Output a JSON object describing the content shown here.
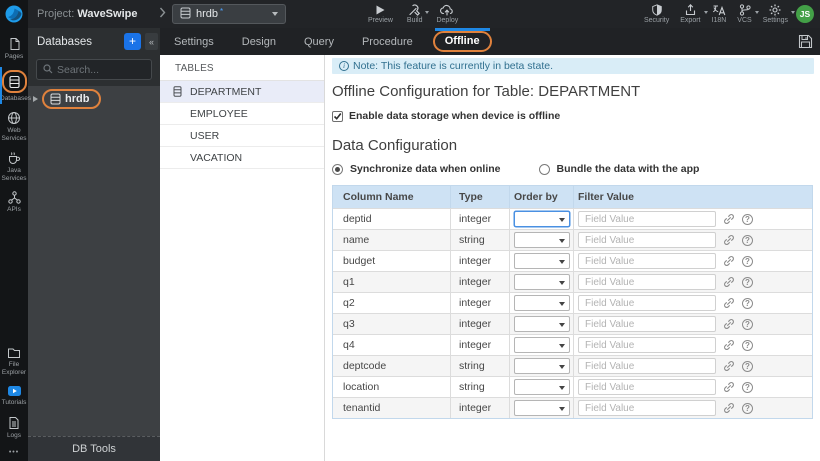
{
  "topbar": {
    "project_label": "Project:",
    "project_name": "WaveSwipe",
    "db_selector": {
      "value": "hrdb",
      "modified": "*"
    },
    "actions": {
      "preview": "Preview",
      "build": "Build",
      "deploy": "Deploy",
      "security": "Security",
      "export": "Export",
      "i18n": "I18N",
      "vcs": "VCS",
      "settings": "Settings"
    },
    "avatar": "JS"
  },
  "sidebar": {
    "items": [
      {
        "label": "Pages"
      },
      {
        "label": "Databases",
        "active": true
      },
      {
        "label": "Web Services"
      },
      {
        "label": "Java Services"
      },
      {
        "label": "APIs"
      },
      {
        "label": "File Explorer"
      },
      {
        "label": "Tutorials"
      },
      {
        "label": "Logs"
      }
    ],
    "more": "•••"
  },
  "db_panel": {
    "title": "Databases",
    "search_placeholder": "Search...",
    "items": [
      {
        "name": "hrdb"
      }
    ],
    "footer": "DB Tools"
  },
  "icons": {
    "add": "+",
    "collapse": "«",
    "info": "i",
    "help": "?"
  },
  "workspace": {
    "tabs": [
      {
        "label": "Settings"
      },
      {
        "label": "Design"
      },
      {
        "label": "Query"
      },
      {
        "label": "Procedure"
      },
      {
        "label": "Offline",
        "active": true
      }
    ]
  },
  "tables_panel": {
    "title": "TABLES",
    "items": [
      {
        "name": "DEPARTMENT",
        "active": true
      },
      {
        "name": "EMPLOYEE"
      },
      {
        "name": "USER"
      },
      {
        "name": "VACATION"
      }
    ]
  },
  "main": {
    "note": "Note: This feature is currently in beta state.",
    "title": "Offline Configuration for Table: DEPARTMENT",
    "enable_label": "Enable data storage when device is offline",
    "enable_checked": true,
    "section_title": "Data Configuration",
    "sync_options": [
      {
        "label": "Synchronize data when online",
        "selected": true
      },
      {
        "label": "Bundle the data with the app",
        "selected": false
      }
    ],
    "table": {
      "headers": [
        "Column Name",
        "Type",
        "Order by",
        "Filter Value"
      ],
      "filter_placeholder": "Field Value",
      "rows": [
        {
          "column": "deptid",
          "type": "integer"
        },
        {
          "column": "name",
          "type": "string"
        },
        {
          "column": "budget",
          "type": "integer"
        },
        {
          "column": "q1",
          "type": "integer"
        },
        {
          "column": "q2",
          "type": "integer"
        },
        {
          "column": "q3",
          "type": "integer"
        },
        {
          "column": "q4",
          "type": "integer"
        },
        {
          "column": "deptcode",
          "type": "string"
        },
        {
          "column": "location",
          "type": "string"
        },
        {
          "column": "tenantid",
          "type": "integer"
        }
      ]
    }
  },
  "colors": {
    "annotation_orange": "#e0823d",
    "accent_blue": "#1a73e8",
    "active_tab_indicator": "#1e88e5",
    "note_bg": "#d9edf7",
    "note_text": "#31708f",
    "table_header_bg": "#cee2f4",
    "avatar_green": "#43a047",
    "topbar_bg": "#222427",
    "panel_bg": "#2c2f31"
  }
}
